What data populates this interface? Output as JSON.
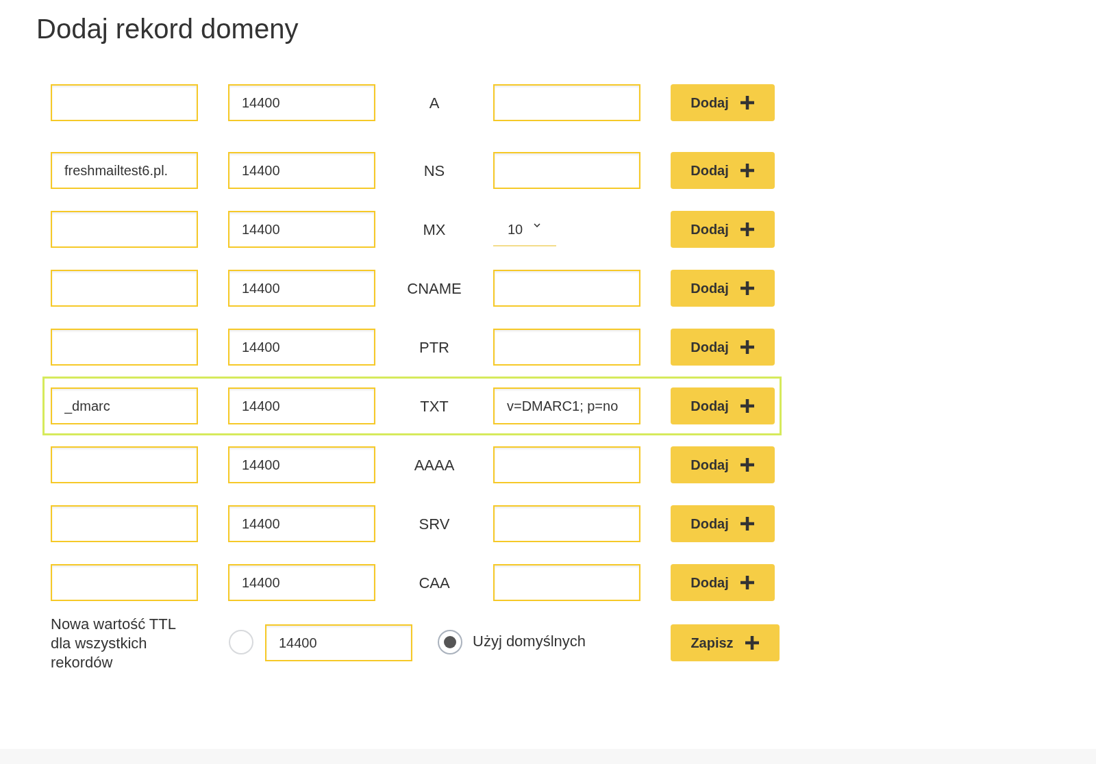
{
  "title": "Dodaj rekord domeny",
  "records": [
    {
      "ttl": "14400",
      "type": "A",
      "kind": "text",
      "highlighted": false,
      "button": "Dodaj"
    },
    {
      "name": "freshmailtest6.pl.",
      "ttl": "14400",
      "type": "NS",
      "kind": "text",
      "highlighted": false,
      "button": "Dodaj"
    },
    {
      "ttl": "14400",
      "type": "MX",
      "kind": "select",
      "value": "10",
      "highlighted": false,
      "button": "Dodaj"
    },
    {
      "ttl": "14400",
      "type": "CNAME",
      "kind": "text",
      "highlighted": false,
      "button": "Dodaj"
    },
    {
      "ttl": "14400",
      "type": "PTR",
      "kind": "text",
      "highlighted": false,
      "button": "Dodaj"
    },
    {
      "name": "_dmarc",
      "ttl": "14400",
      "type": "TXT",
      "kind": "text",
      "value": "v=DMARC1; p=no",
      "highlighted": true,
      "button": "Dodaj"
    },
    {
      "ttl": "14400",
      "type": "AAAA",
      "kind": "text",
      "highlighted": false,
      "button": "Dodaj"
    },
    {
      "ttl": "14400",
      "type": "SRV",
      "kind": "text",
      "highlighted": false,
      "button": "Dodaj"
    },
    {
      "ttl": "14400",
      "type": "CAA",
      "kind": "text",
      "highlighted": false,
      "button": "Dodaj"
    }
  ],
  "ttl_all": {
    "label": "Nowa wartość TTL dla wszystkich rekordów",
    "custom_selected": false,
    "value": "14400",
    "default_selected": true,
    "default_label": "Użyj domyślnych",
    "button": "Zapisz"
  }
}
